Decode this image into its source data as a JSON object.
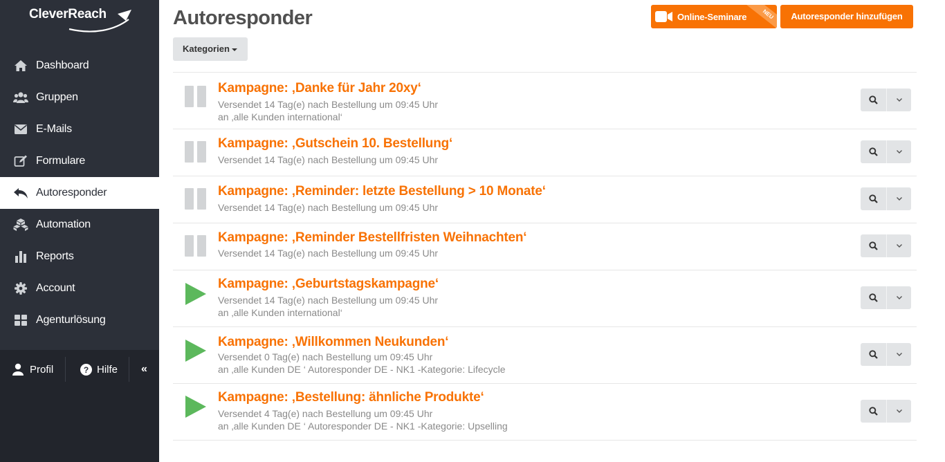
{
  "logo": {
    "text": "CleverReach"
  },
  "sidebar": {
    "items": [
      {
        "label": "Dashboard",
        "icon": "home-icon"
      },
      {
        "label": "Gruppen",
        "icon": "users-icon"
      },
      {
        "label": "E-Mails",
        "icon": "envelope-icon"
      },
      {
        "label": "Formulare",
        "icon": "edit-icon"
      },
      {
        "label": "Autoresponder",
        "icon": "reply-icon",
        "active": true
      },
      {
        "label": "Automation",
        "icon": "cubes-icon"
      },
      {
        "label": "Reports",
        "icon": "bar-chart-icon"
      },
      {
        "label": "Account",
        "icon": "gear-icon"
      },
      {
        "label": "Agenturlösung",
        "icon": "grid-icon"
      }
    ],
    "bottom": {
      "profil": "Profil",
      "hilfe": "Hilfe",
      "collapse": "«"
    }
  },
  "header": {
    "title": "Autoresponder",
    "seminar_button": "Online-Seminare",
    "seminar_badge": "NEU",
    "add_button": "Autoresponder hinzufügen",
    "kategorien": "Kategorien"
  },
  "colors": {
    "accent": "#f87204",
    "sidebar": "#2c3039",
    "play": "#5cb85c",
    "pause": "#d2d4d6"
  },
  "campaigns": [
    {
      "status": "paused",
      "title": "Kampagne: ‚Danke für Jahr 20xy‘",
      "line1": "Versendet 14 Tag(e) nach Bestellung um 09:45 Uhr",
      "line2": "an ‚alle Kunden international‘"
    },
    {
      "status": "paused",
      "title": "Kampagne: ‚Gutschein 10. Bestellung‘",
      "line1": "Versendet 14 Tag(e) nach Bestellung um 09:45 Uhr",
      "line2": ""
    },
    {
      "status": "paused",
      "title": "Kampagne: ‚Reminder: letzte Bestellung > 10 Monate‘",
      "line1": "Versendet 14 Tag(e) nach Bestellung um 09:45 Uhr",
      "line2": ""
    },
    {
      "status": "paused",
      "title": "Kampagne: ‚Reminder Bestellfristen Weihnachten‘",
      "line1": "Versendet 14 Tag(e) nach Bestellung um 09:45 Uhr",
      "line2": ""
    },
    {
      "status": "active",
      "title": "Kampagne: ‚Geburtstagskampagne‘",
      "line1": "Versendet 14 Tag(e) nach Bestellung um 09:45 Uhr",
      "line2": "an ‚alle Kunden international‘"
    },
    {
      "status": "active",
      "title": "Kampagne: ‚Willkommen Neukunden‘",
      "line1": "Versendet 0 Tag(e) nach Bestellung um 09:45 Uhr",
      "line2": "an ‚alle Kunden DE ‘  Autoresponder DE - NK1 -Kategorie: Lifecycle"
    },
    {
      "status": "active",
      "title": "Kampagne: ‚Bestellung: ähnliche Produkte‘",
      "line1": "Versendet 4 Tag(e) nach Bestellung um 09:45 Uhr",
      "line2": "an ‚alle Kunden DE ‘  Autoresponder DE - NK1 -Kategorie: Upselling"
    }
  ]
}
